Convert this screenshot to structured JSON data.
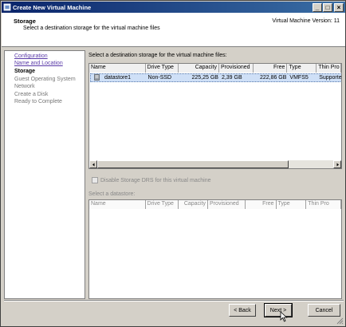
{
  "window": {
    "title": "Create New Virtual Machine",
    "controls": {
      "minimize": "_",
      "maximize": "□",
      "close": "×"
    }
  },
  "header": {
    "title": "Storage",
    "subtitle": "Select a destination storage for the virtual machine files",
    "version": "Virtual Machine Version: 11"
  },
  "nav": {
    "items": [
      {
        "label": "Configuration",
        "state": "link"
      },
      {
        "label": "Name and Location",
        "state": "link"
      },
      {
        "label": "Storage",
        "state": "current"
      },
      {
        "label": "Guest Operating System",
        "state": "disabled"
      },
      {
        "label": "Network",
        "state": "disabled"
      },
      {
        "label": "Create a Disk",
        "state": "disabled"
      },
      {
        "label": "Ready to Complete",
        "state": "disabled"
      }
    ]
  },
  "main": {
    "select_label": "Select a destination storage for the virtual machine files:",
    "columns": [
      "Name",
      "Drive Type",
      "Capacity",
      "Provisioned",
      "Free",
      "Type",
      "Thin Pro"
    ],
    "rows": [
      {
        "name": "datastore1",
        "drive_type": "Non-SSD",
        "capacity": "225,25 GB",
        "provisioned": "2,39 GB",
        "free": "222,86 GB",
        "type": "VMFS5",
        "thin": "Supporte"
      }
    ],
    "drs_checkbox_label": "Disable Storage DRS for this virtual machine",
    "drs_checked": false,
    "datastore_label": "Select a datastore:",
    "columns2": [
      "Name",
      "Drive Type",
      "Capacity",
      "Provisioned",
      "Free",
      "Type",
      "Thin Pro"
    ]
  },
  "buttons": {
    "back": "< Back",
    "next": "Next >",
    "cancel": "Cancel"
  },
  "icons": [
    "app-icon",
    "datastore-icon",
    "scroll-left-icon",
    "scroll-right-icon",
    "scroll-up-icon",
    "scroll-down-icon",
    "mouse-cursor-icon",
    "resize-grip-icon"
  ],
  "colors": {
    "titlebar_start": "#0a246a",
    "titlebar_end": "#3a6ea5",
    "selected_row": "#cfe0f7",
    "link": "#5a3aa8"
  }
}
